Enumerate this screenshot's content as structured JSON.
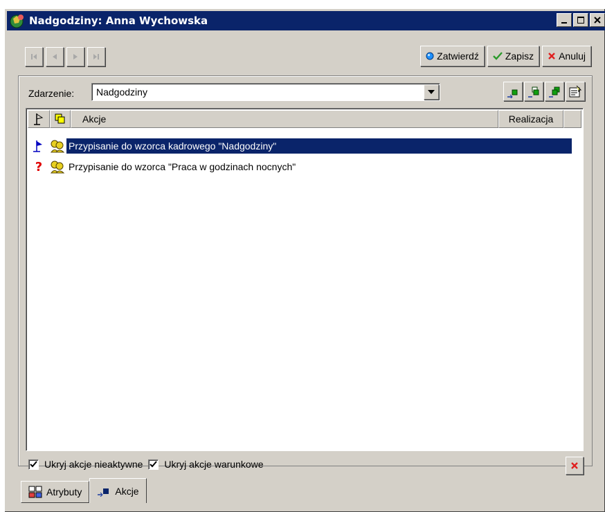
{
  "window": {
    "title": "Nadgodziny: Anna Wychowska"
  },
  "titlebar_buttons": {
    "minimize": "minimize-icon",
    "maximize": "maximize-icon",
    "close": "close-icon"
  },
  "nav": {
    "first": "first-record-icon",
    "prev": "previous-record-icon",
    "next": "next-record-icon",
    "last": "last-record-icon"
  },
  "actions": {
    "confirm": "Zatwierdź",
    "save": "Zapisz",
    "cancel": "Anuluj"
  },
  "event": {
    "label": "Zdarzenie:",
    "value": "Nadgodziny"
  },
  "grid": {
    "columns": [
      "Akcje",
      "Realizacja"
    ],
    "rows": [
      {
        "status_icon": "flag-icon",
        "type_icon": "people-icon",
        "text": "Przypisanie do wzorca kadrowego \"Nadgodziny\"",
        "realizacja": "",
        "selected": true
      },
      {
        "status_icon": "question-icon",
        "type_icon": "people-icon",
        "text": "Przypisanie do wzorca \"Praca w godzinach nocnych\"",
        "realizacja": "",
        "selected": false
      }
    ]
  },
  "options": {
    "hide_inactive": "Ukryj akcje nieaktywne",
    "hide_conditional": "Ukryj akcje warunkowe"
  },
  "tabs": [
    {
      "label": "Atrybuty",
      "active": false
    },
    {
      "label": "Akcje",
      "active": true
    }
  ],
  "colors": {
    "title_bar": "#0a246a",
    "selection": "#0a246a",
    "face": "#d4d0c8",
    "green": "#008000",
    "red": "#ff0000"
  }
}
